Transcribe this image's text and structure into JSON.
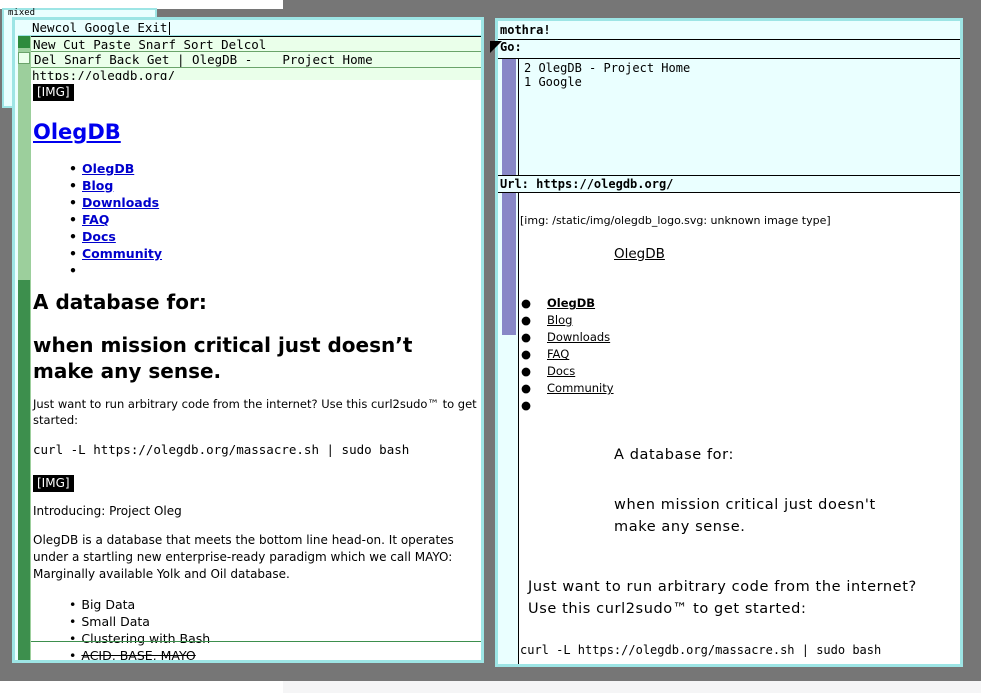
{
  "mini_window": {
    "label": "mixed"
  },
  "left_window": {
    "column_tag": "Newcol Google Exit",
    "window_tag": "New Cut Paste Snarf Sort Delcol",
    "body_tag": "Del Snarf Back Get | OlegDB -    Project Home",
    "url": "https://olegdb.org/",
    "img_placeholder": "[IMG]",
    "site_title": "OlegDB",
    "nav": [
      "OlegDB",
      "Blog",
      "Downloads",
      "FAQ",
      "Docs",
      "Community",
      ""
    ],
    "headline1": "A database for:",
    "headline2": "when mission critical just doesn’t make any sense.",
    "intro": "Just want to run arbitrary code from the internet? Use this curl2sudo™ to get started:",
    "command": "curl -L https://olegdb.org/massacre.sh | sudo bash",
    "img_placeholder2": "[IMG]",
    "introducing": "Introducing: Project Oleg",
    "description": "OlegDB is a database that meets the bottom line head-on. It operates under a startling new enterprise-ready paradigm which we call MAYO: Marginally available Yolk and Oil database.",
    "features": [
      "Big Data",
      "Small Data",
      "Clustering with Bash",
      "ACID, BASE, MAYO"
    ]
  },
  "right_window": {
    "title": "mothra!",
    "go_label": "Go:",
    "history": [
      "2 OlegDB - Project Home",
      "1 Google"
    ],
    "url_label": "Url: https://olegdb.org/",
    "img_error": "[img: /static/img/olegdb_logo.svg: unknown image type]",
    "site_title": "OlegDB",
    "nav": [
      "OlegDB",
      "Blog",
      "Downloads",
      "FAQ",
      "Docs",
      "Community",
      ""
    ],
    "headline1": "A database for:",
    "headline2_line1": "when mission critical just doesn't",
    "headline2_line2": "make any sense.",
    "intro_line1": "Just want to run arbitrary code from the internet?",
    "intro_line2": "Use this curl2sudo™ to get started:",
    "command": "curl -L https://olegdb.org/massacre.sh | sudo bash"
  }
}
